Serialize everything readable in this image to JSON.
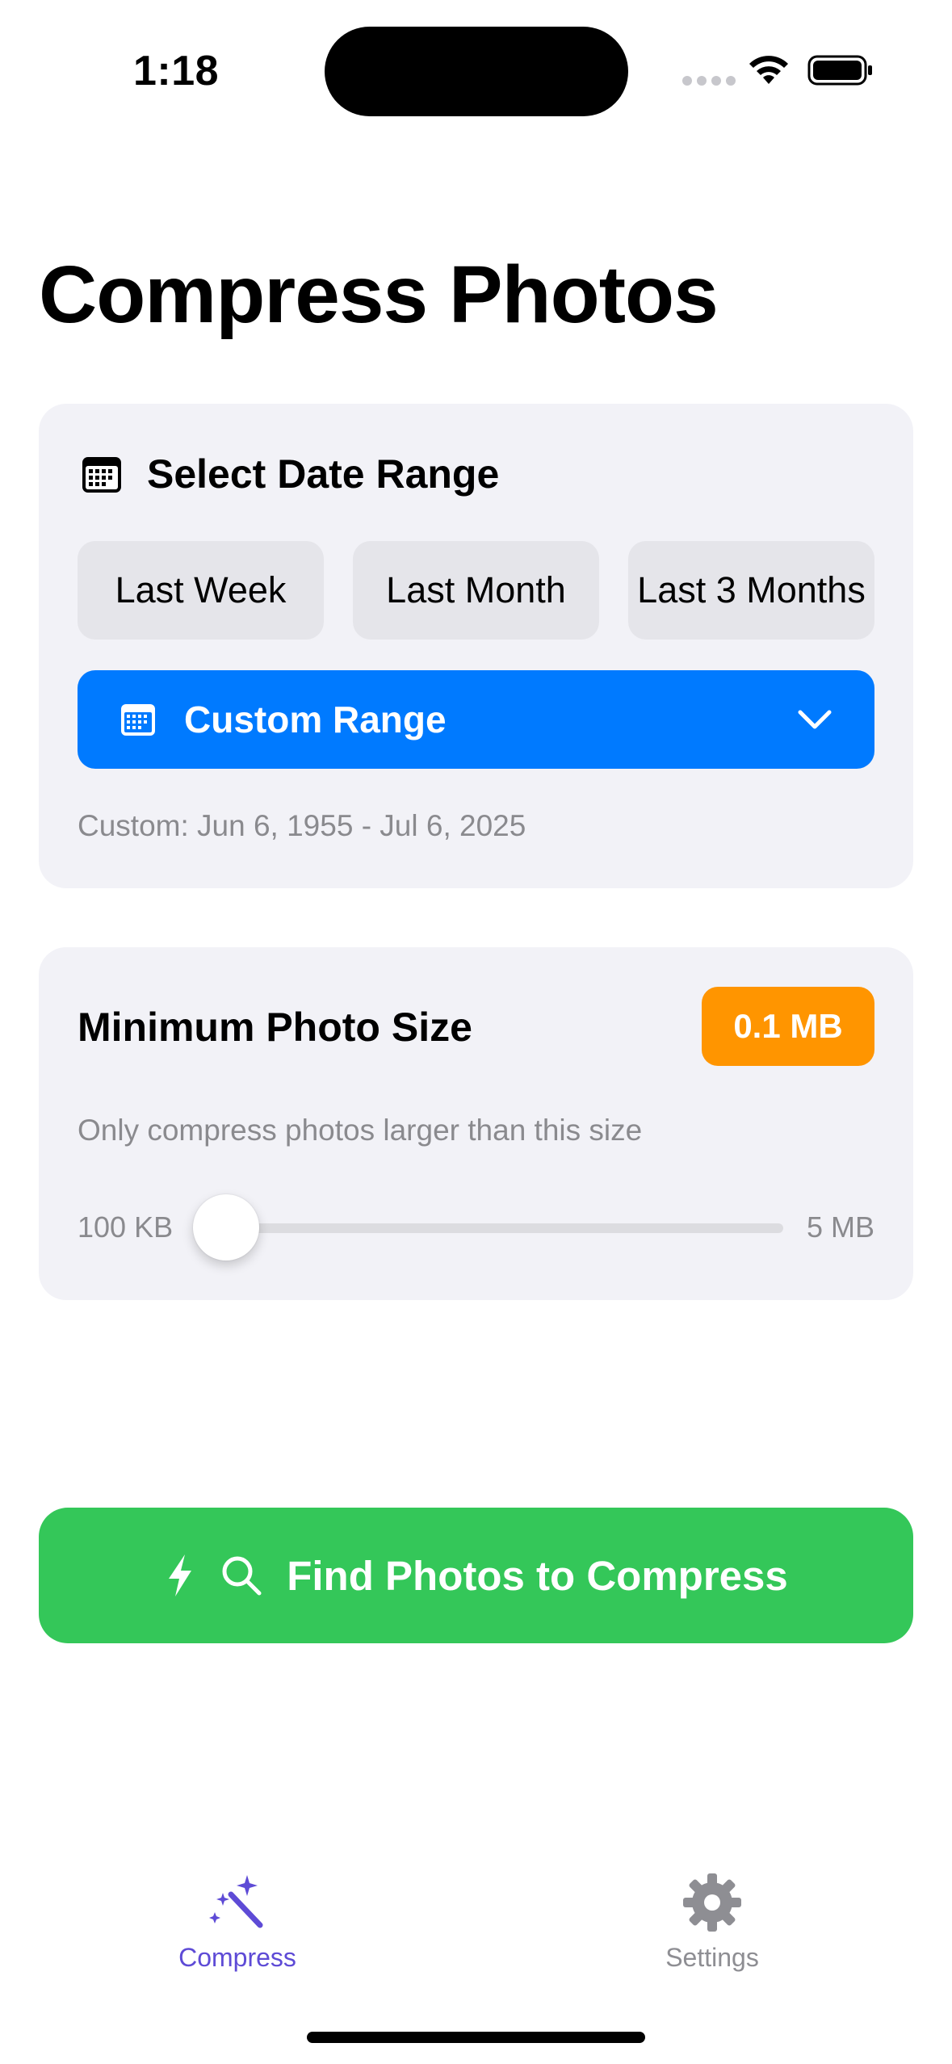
{
  "status_bar": {
    "time": "1:18"
  },
  "page": {
    "title": "Compress Photos"
  },
  "date_range": {
    "title": "Select Date Range",
    "presets": [
      {
        "label": "Last Week"
      },
      {
        "label": "Last Month"
      },
      {
        "label": "Last 3 Months"
      }
    ],
    "custom_button_label": "Custom Range",
    "custom_range_text": "Custom: Jun 6, 1955 - Jul 6, 2025"
  },
  "min_size": {
    "title": "Minimum Photo Size",
    "value_badge": "0.1 MB",
    "hint": "Only compress photos larger than this size",
    "slider_min_label": "100 KB",
    "slider_max_label": "5 MB",
    "slider_fraction": 0.0
  },
  "actions": {
    "find_label": "Find Photos to Compress"
  },
  "tab_bar": {
    "tabs": [
      {
        "label": "Compress",
        "icon": "magic-wand-icon",
        "selected": true
      },
      {
        "label": "Settings",
        "icon": "gear-icon",
        "selected": false
      }
    ]
  },
  "colors": {
    "primary_blue": "#007aff",
    "badge_orange": "#ff9500",
    "action_green": "#34c759",
    "tab_selected": "#5e4bd6",
    "tab_unselected": "#8e8e93",
    "card_background": "#f2f2f7"
  }
}
